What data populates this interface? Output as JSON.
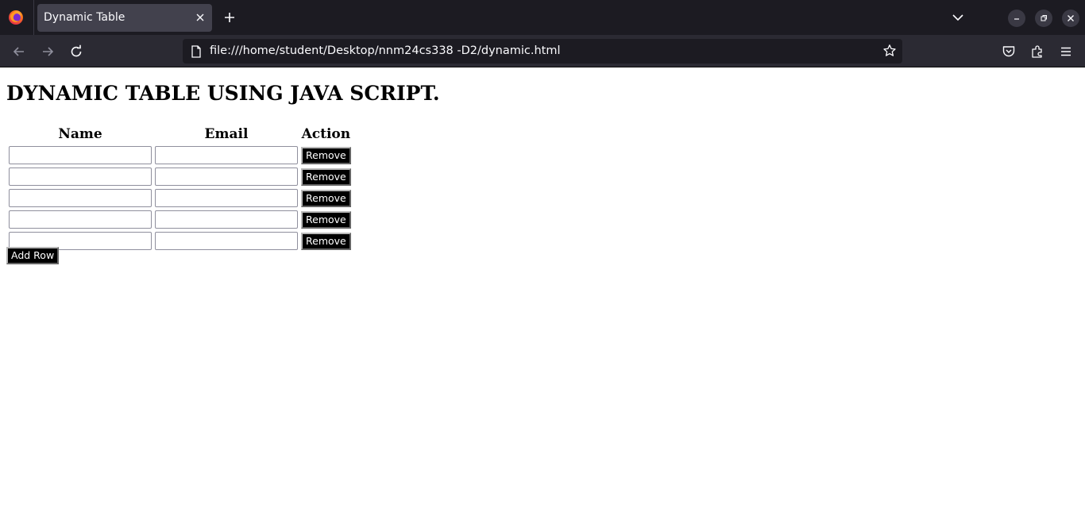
{
  "browser": {
    "tab_title": "Dynamic Table",
    "url": "file:///home/student/Desktop/nnm24cs338 -D2/dynamic.html",
    "colors": {
      "titlebar": "#1c1b22",
      "tab": "#42414d",
      "toolbar": "#2b2a33",
      "urlbar": "#1c1b22",
      "text": "#fbfbfe"
    }
  },
  "page": {
    "heading": "DYNAMIC TABLE USING JAVA SCRIPT.",
    "table": {
      "headers": [
        "Name",
        "Email",
        "Action"
      ],
      "rows": [
        {
          "name": "",
          "email": "",
          "action": "Remove"
        },
        {
          "name": "",
          "email": "",
          "action": "Remove"
        },
        {
          "name": "",
          "email": "",
          "action": "Remove"
        },
        {
          "name": "",
          "email": "",
          "action": "Remove"
        },
        {
          "name": "",
          "email": "",
          "action": "Remove"
        }
      ]
    },
    "add_row_label": "Add Row",
    "colors": {
      "button_bg": "#000000",
      "button_text": "#ffffff"
    }
  }
}
